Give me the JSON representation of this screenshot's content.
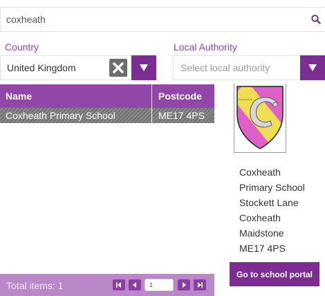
{
  "search": {
    "value": "coxheath",
    "icon": "search-icon"
  },
  "filters": {
    "country_label": "Country",
    "country_value": "United Kingdom",
    "local_authority_label": "Local Authority",
    "local_authority_placeholder": "Select local authority"
  },
  "table": {
    "headers": [
      "Name",
      "Postcode"
    ],
    "rows": [
      {
        "name": "Coxheath Primary School",
        "postcode": "ME17 4PS"
      }
    ]
  },
  "pager": {
    "total_text": "Total items: 1",
    "current_page": "1"
  },
  "school": {
    "address_lines": [
      "Coxheath",
      "Primary School",
      "Stockett Lane",
      "Coxheath",
      "Maidstone",
      "ME17 4PS"
    ],
    "portal_button": "Go to school portal"
  },
  "colors": {
    "accent": "#7b2d91",
    "header": "#9146a8",
    "pager": "#b889c6",
    "label": "#8e44ad"
  }
}
